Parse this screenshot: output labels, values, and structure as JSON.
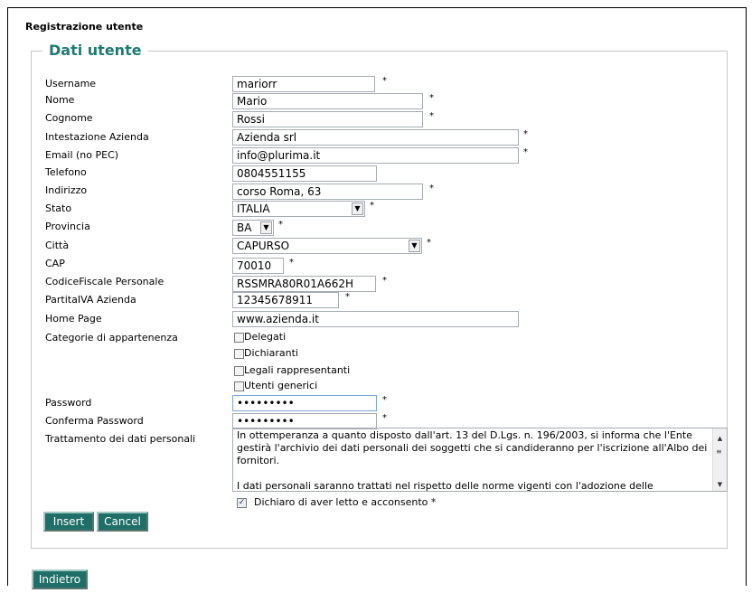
{
  "page": {
    "title": "Registrazione utente",
    "section_title": "Dati utente"
  },
  "fields": {
    "username": {
      "label": "Username",
      "value": "mariorr",
      "required": "*"
    },
    "nome": {
      "label": "Nome",
      "value": "Mario",
      "required": "*"
    },
    "cognome": {
      "label": "Cognome",
      "value": "Rossi",
      "required": "*"
    },
    "azienda": {
      "label": "Intestazione Azienda",
      "value": "Azienda srl",
      "required": "*"
    },
    "email": {
      "label": "Email (no PEC)",
      "value": "info@plurima.it",
      "required": "*"
    },
    "telefono": {
      "label": "Telefono",
      "value": "0804551155"
    },
    "indirizzo": {
      "label": "Indirizzo",
      "value": "corso Roma, 63",
      "required": "*"
    },
    "stato": {
      "label": "Stato",
      "value": "ITALIA",
      "required": "*"
    },
    "provincia": {
      "label": "Provincia",
      "value": "BA",
      "required": "*"
    },
    "citta": {
      "label": "Città",
      "value": "CAPURSO",
      "required": "*"
    },
    "cap": {
      "label": "CAP",
      "value": "70010",
      "required": "*"
    },
    "codice_fiscale": {
      "label": "CodiceFiscale Personale",
      "value": "RSSMRA80R01A662H",
      "required": "*"
    },
    "partita_iva": {
      "label": "PartitaIVA Azienda",
      "value": "12345678911",
      "required": "*"
    },
    "home_page": {
      "label": "Home Page",
      "value": "www.azienda.it"
    },
    "password": {
      "label": "Password",
      "value": "•••••••••",
      "required": "*"
    },
    "conferma_password": {
      "label": "Conferma Password",
      "value": "•••••••••",
      "required": "*"
    }
  },
  "categorie": {
    "label": "Categorie di appartenenza",
    "options": [
      "Delegati",
      "Dichiaranti",
      "Legali rappresentanti",
      "Utenti generici"
    ]
  },
  "privacy": {
    "label": "Trattamento dei dati personali",
    "text": "In ottemperanza a quanto disposto dall'art. 13 del D.Lgs. n. 196/2003, si informa che l'Ente gestirà l'archivio dei dati personali dei soggetti che si candideranno per l'iscrizione all'Albo dei fornitori.\n\nI dati personali saranno trattati nel rispetto delle norme vigenti con l'adozione delle",
    "consent_label": "Dichiaro di aver letto e acconsento *"
  },
  "buttons": {
    "insert": "Insert",
    "cancel": "Cancel",
    "back": "Indietro"
  },
  "colors": {
    "accent": "#1f7a72",
    "button_bg": "#1f6f68"
  }
}
